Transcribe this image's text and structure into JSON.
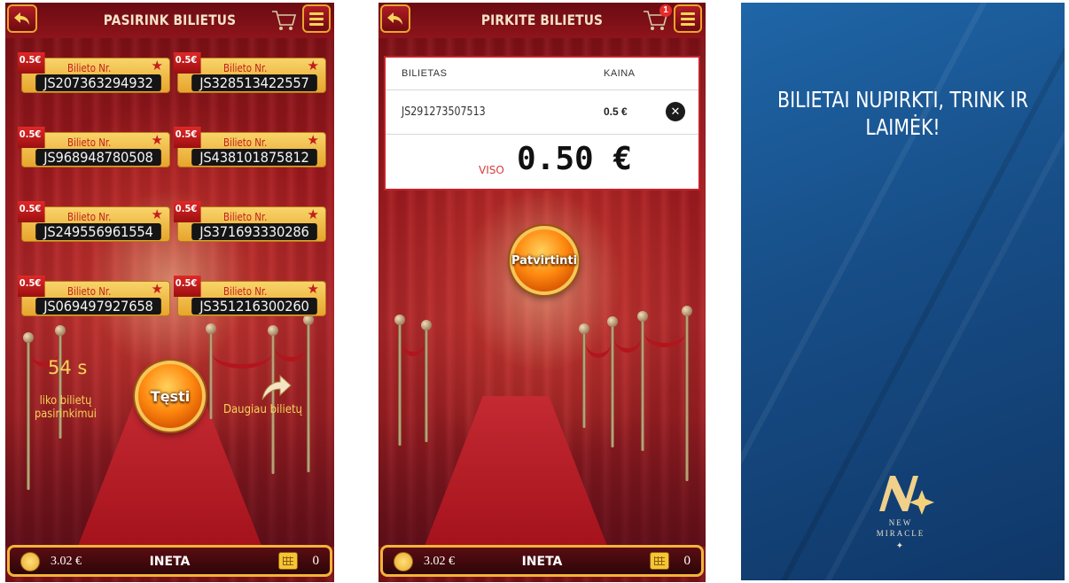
{
  "screen_select": {
    "title": "PASIRINK BILIETUS",
    "tickets": [
      {
        "price": "0.5€",
        "label": "Bilieto Nr.",
        "number": "JS207363294932"
      },
      {
        "price": "0.5€",
        "label": "Bilieto Nr.",
        "number": "JS328513422557"
      },
      {
        "price": "0.5€",
        "label": "Bilieto Nr.",
        "number": "JS968948780508"
      },
      {
        "price": "0.5€",
        "label": "Bilieto Nr.",
        "number": "JS438101875812"
      },
      {
        "price": "0.5€",
        "label": "Bilieto Nr.",
        "number": "JS249556961554"
      },
      {
        "price": "0.5€",
        "label": "Bilieto Nr.",
        "number": "JS371693330286"
      },
      {
        "price": "0.5€",
        "label": "Bilieto Nr.",
        "number": "JS069497927658"
      },
      {
        "price": "0.5€",
        "label": "Bilieto Nr.",
        "number": "JS351216300260"
      }
    ],
    "timer": "54 s",
    "timer_label": "liko bilietų pasirinkimui",
    "continue_label": "Tęsti",
    "more_label": "Daugiau bilietų",
    "footer": {
      "balance": "3.02 €",
      "user": "INETA",
      "ticket_count": "0"
    }
  },
  "screen_cart": {
    "title": "PIRKITE BILIETUS",
    "cart_badge": "1",
    "table": {
      "headers": [
        "BILIETAS",
        "KAINA"
      ],
      "rows": [
        {
          "ticket": "JS291273507513",
          "price": "0.5 €"
        }
      ],
      "total_label": "VISO",
      "total_value": "0.50 €"
    },
    "confirm_label": "Patvirtinti",
    "footer": {
      "balance": "3.02 €",
      "user": "INETA",
      "ticket_count": "0"
    }
  },
  "screen_done": {
    "message": "BILIETAI NUPIRKTI, TRINK IR LAIMĖK!",
    "logo_line1": "NEW",
    "logo_line2": "MIRACLE"
  },
  "colors": {
    "gold": "#f2b43a",
    "red": "#a31a1f",
    "blue": "#174d86",
    "orange": "#ff8a10"
  }
}
